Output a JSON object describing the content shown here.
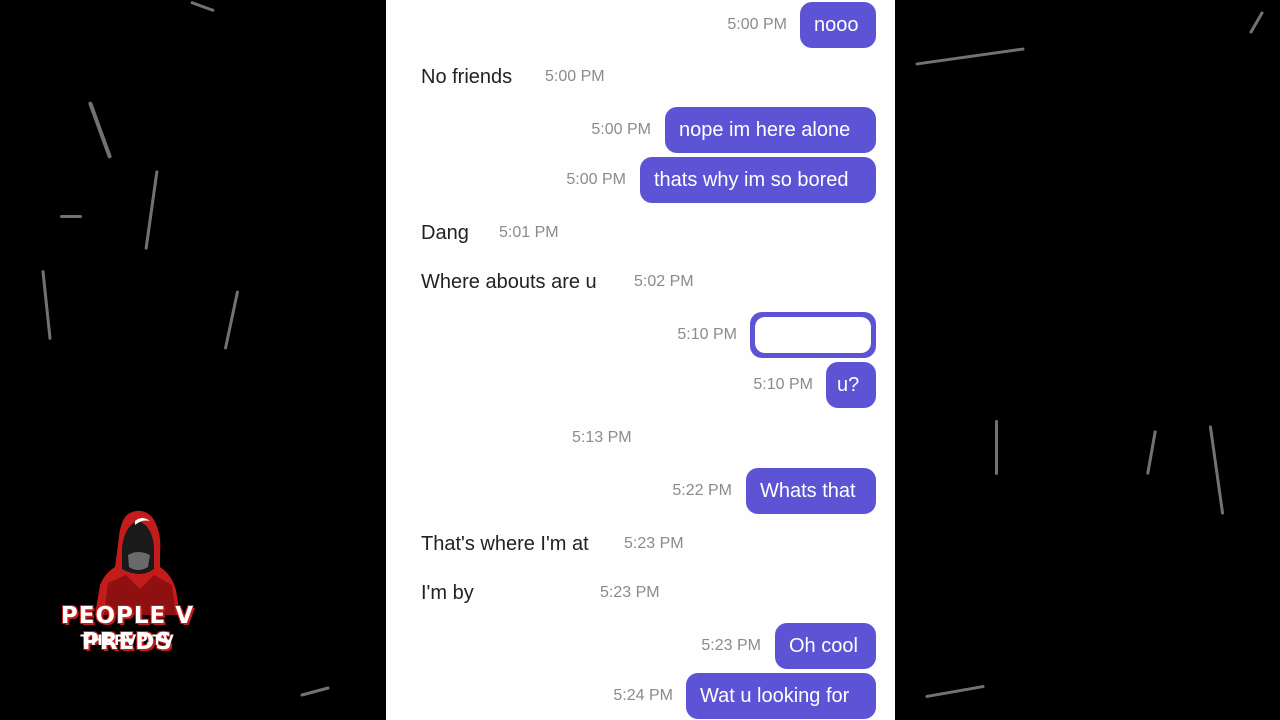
{
  "colors": {
    "bubble": "#5c54d4",
    "timestamp": "#8b8b8b",
    "panel": "#fefefe",
    "background": "#000000",
    "logo_accent": "#c41b1b"
  },
  "logo": {
    "title": "PEOPLE V PREDS",
    "subtitle": "THEPVP.TV",
    "icon": "hooded-figure-icon"
  },
  "messages": [
    {
      "dir": "out",
      "text": "nooo",
      "time": "5:00 PM"
    },
    {
      "dir": "in",
      "text": "No friends",
      "time": "5:00 PM"
    },
    {
      "dir": "out",
      "text": "nope im here alone",
      "time": "5:00 PM"
    },
    {
      "dir": "out",
      "text": "thats why im so bored",
      "time": "5:00 PM"
    },
    {
      "dir": "in",
      "text": "Dang",
      "time": "5:01 PM"
    },
    {
      "dir": "in",
      "text": "Where abouts are u",
      "time": "5:02 PM"
    },
    {
      "dir": "out",
      "text": "",
      "time": "5:10 PM"
    },
    {
      "dir": "out",
      "text": "u?",
      "time": "5:10 PM"
    },
    {
      "dir": "in",
      "text": "",
      "time": "5:13 PM"
    },
    {
      "dir": "out",
      "text": "Whats that",
      "time": "5:22 PM"
    },
    {
      "dir": "in",
      "text": "That's where I'm at",
      "time": "5:23 PM"
    },
    {
      "dir": "in",
      "text": "I'm by",
      "time": "5:23 PM"
    },
    {
      "dir": "out",
      "text": "Oh cool",
      "time": "5:23 PM"
    },
    {
      "dir": "out",
      "text": "Wat u looking for",
      "time": "5:24 PM"
    }
  ]
}
